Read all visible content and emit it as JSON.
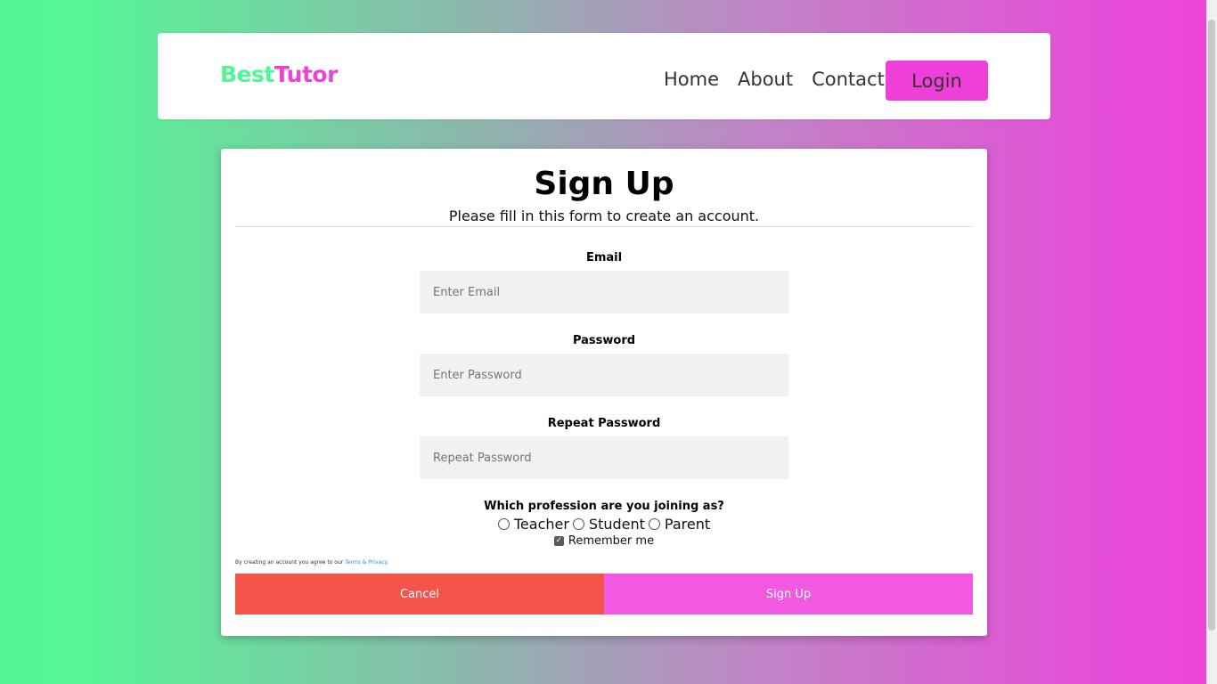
{
  "header": {
    "logo_part1": "Best",
    "logo_part2": "Tutor",
    "nav": [
      "Home",
      "About",
      "Contact"
    ],
    "login_label": "Login"
  },
  "form": {
    "title": "Sign Up",
    "subtitle": "Please fill in this form to create an account.",
    "email": {
      "label": "Email",
      "placeholder": "Enter Email",
      "value": ""
    },
    "password": {
      "label": "Password",
      "placeholder": "Enter Password",
      "value": ""
    },
    "repeat_password": {
      "label": "Repeat Password",
      "placeholder": "Repeat Password",
      "value": ""
    },
    "profession_question": "Which profession are you joining as?",
    "profession_options": [
      "Teacher",
      "Student",
      "Parent"
    ],
    "profession_selected": null,
    "remember_label": "Remember me",
    "remember_checked": true,
    "terms_text": "By creating an account you agree to our",
    "terms_link": "Terms & Privacy.",
    "cancel_label": "Cancel",
    "signup_label": "Sign Up"
  },
  "colors": {
    "accent_green": "#52f793",
    "accent_pink": "#ee3fd8",
    "cancel_red": "#f4544b",
    "signup_pink": "#f159e0"
  }
}
